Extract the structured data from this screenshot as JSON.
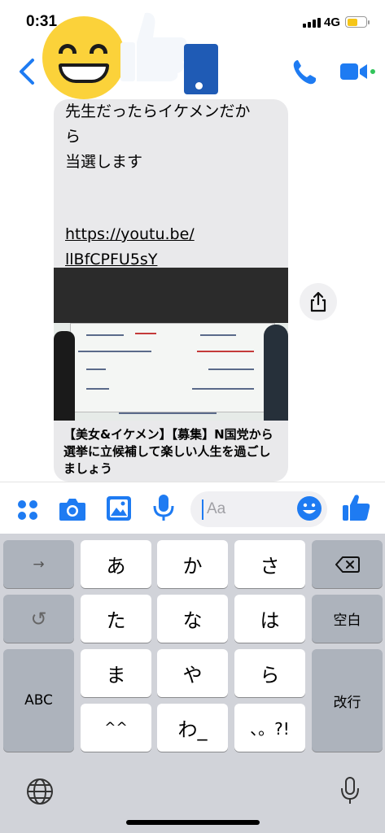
{
  "status_bar": {
    "time": "0:31",
    "network": "4G",
    "battery_percent": 55
  },
  "header": {
    "icons": [
      "back-chevron-icon",
      "phone-icon",
      "video-camera-icon"
    ],
    "active_color": "#31c45a"
  },
  "message": {
    "lines": [
      "先生だったらイケメンだか",
      "ら",
      "当選します"
    ],
    "link_lines": [
      "https://youtu.be/",
      "llBfCPFU5sY"
    ],
    "preview_title": "【美女&イケメン】【募集】N国党から選挙に立候補して楽しい人生を過ごしましょう"
  },
  "composer": {
    "placeholder": "Aa",
    "icons": [
      "grid-dots-icon",
      "camera-icon",
      "image-icon",
      "microphone-icon",
      "emoji-icon",
      "thumbs-up-icon"
    ],
    "accent": "#1e7bf2"
  },
  "keyboard": {
    "row1": [
      "→",
      "あ",
      "か",
      "さ",
      "⌫"
    ],
    "row2": [
      "↺",
      "た",
      "な",
      "は",
      "空白"
    ],
    "row3": [
      "ABC",
      "ま",
      "や",
      "ら",
      "改行"
    ],
    "row4": [
      "^^",
      "わ_",
      "、。?!"
    ]
  }
}
